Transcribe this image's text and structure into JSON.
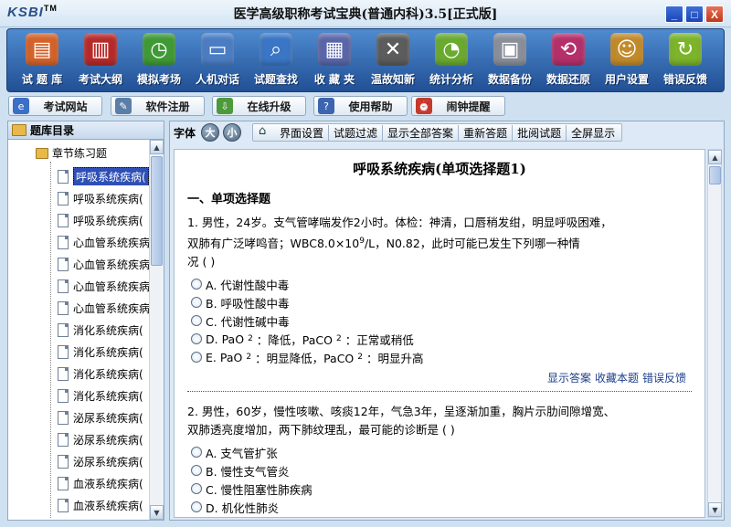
{
  "window": {
    "logo": "KSBI",
    "logo_tm": "TM",
    "title": "医学高级职称考试宝典(普通内科)3.5[正式版]",
    "buttons": [
      "_",
      "□",
      "X"
    ]
  },
  "toolbar": {
    "items": [
      {
        "label": "试 题 库",
        "icon": "book-icon",
        "color": "#d4622a"
      },
      {
        "label": "考试大纲",
        "icon": "chart-book-icon",
        "color": "#b72a2a"
      },
      {
        "label": "模拟考场",
        "icon": "clock-icon",
        "color": "#3f9a35"
      },
      {
        "label": "人机对话",
        "icon": "monitor-icon",
        "color": "#4b7dc4"
      },
      {
        "label": "试题查找",
        "icon": "magnifier-icon",
        "color": "#3a76c5"
      },
      {
        "label": "收 藏 夹",
        "icon": "folder-icon",
        "color": "#5a66a8"
      },
      {
        "label": "温故知新",
        "icon": "close-board-icon",
        "color": "#5c5c5c"
      },
      {
        "label": "统计分析",
        "icon": "pie-chart-icon",
        "color": "#6aaa2f"
      },
      {
        "label": "数据备份",
        "icon": "database-icon",
        "color": "#8a8f99"
      },
      {
        "label": "数据还原",
        "icon": "restore-icon",
        "color": "#b52f6a"
      },
      {
        "label": "用户设置",
        "icon": "user-icon",
        "color": "#c28a2a"
      },
      {
        "label": "错误反馈",
        "icon": "refresh-icon",
        "color": "#7cb42a"
      }
    ]
  },
  "subbar": {
    "buttons": [
      {
        "label": "考试网站",
        "icon": "ie-icon",
        "color": "#3b6fc8"
      },
      {
        "label": "软件注册",
        "icon": "register-icon",
        "color": "#5b7ea8"
      },
      {
        "label": "在线升级",
        "icon": "download-icon",
        "color": "#4c9a3a"
      },
      {
        "label": "使用帮助",
        "icon": "help-icon",
        "color": "#3c64b0"
      },
      {
        "label": "闹钟提醒",
        "icon": "alarm-icon",
        "color": "#c23a2a"
      }
    ]
  },
  "tree": {
    "header": "题库目录",
    "root": "章节练习题",
    "items": [
      "呼吸系统疾病(",
      "呼吸系统疾病(",
      "呼吸系统疾病(",
      "心血管系统疾病",
      "心血管系统疾病",
      "心血管系统疾病",
      "心血管系统疾病",
      "消化系统疾病(",
      "消化系统疾病(",
      "消化系统疾病(",
      "消化系统疾病(",
      "泌尿系统疾病(",
      "泌尿系统疾病(",
      "泌尿系统疾病(",
      "血液系统疾病(",
      "血液系统疾病("
    ]
  },
  "right_toolbar": {
    "font_label": "字体",
    "font_big": "大",
    "font_small": "小",
    "tabs": [
      "界面设置",
      "试题过滤",
      "显示全部答案",
      "重新答题",
      "批阅试题",
      "全屏显示"
    ]
  },
  "doc": {
    "title": "呼吸系统疾病(单项选择题1)",
    "section": "一、单项选择题",
    "q1": {
      "line1": "1. 男性，24岁。支气管哮喘发作2小时。体检：神清，口唇稍发绀，明显呼吸困难，",
      "line2_a": "双肺有广泛哮鸣音；WBC8.0×10",
      "line2_sup": "9",
      "line2_b": "/L，N0.82，此时可能已发生下列哪一种情",
      "line3": "况  (    )",
      "options": [
        {
          "a": "A. 代谢性酸中毒"
        },
        {
          "a": "B. 呼吸性酸中毒"
        },
        {
          "a": "C. 代谢性碱中毒"
        },
        {
          "a": "D. PaO",
          "s1": "2",
          "b": "：降低，PaCO",
          "s2": "2",
          "c": "：正常或稍低"
        },
        {
          "a": "E. PaO",
          "s1": "2",
          "b": "：明显降低，PaCO",
          "s2": "2",
          "c": "：明显升高"
        }
      ],
      "actions": [
        "显示答案",
        "收藏本题",
        "错误反馈"
      ]
    },
    "q2": {
      "line1": "2. 男性，60岁，慢性咳嗽、咳痰12年，气急3年，呈逐渐加重，胸片示肋间隙增宽、",
      "line2": "双肺透亮度增加，两下肺纹理乱，最可能的诊断是  (    )",
      "options": [
        "A. 支气管扩张",
        "B. 慢性支气管炎",
        "C. 慢性阻塞性肺疾病",
        "D. 机化性肺炎"
      ]
    }
  }
}
